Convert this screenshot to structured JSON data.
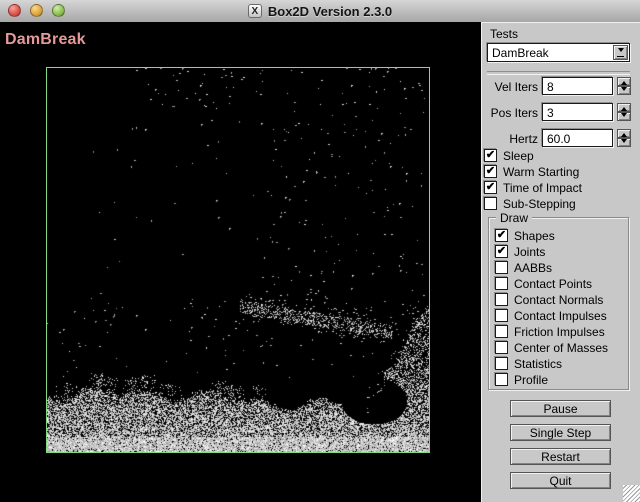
{
  "window": {
    "title": "Box2D Version 2.3.0"
  },
  "titlebar": {
    "app_icon_glyph": "X",
    "traffic_lights": [
      {
        "name": "close",
        "color": "#dd5149"
      },
      {
        "name": "minimize",
        "color": "#dda43c"
      },
      {
        "name": "zoom",
        "color": "#8abf4e"
      }
    ]
  },
  "viewport": {
    "test_label": "DamBreak",
    "label_color": "#e69999",
    "border_color": "#84da84",
    "background": "#000000"
  },
  "sidebar": {
    "tests_label": "Tests",
    "tests_value": "DamBreak",
    "spinners": [
      {
        "label": "Vel Iters",
        "value": "8"
      },
      {
        "label": "Pos Iters",
        "value": "3"
      },
      {
        "label": "Hertz",
        "value": "60.0"
      }
    ],
    "checkboxes": [
      {
        "label": "Sleep",
        "checked": true,
        "mark": "✔"
      },
      {
        "label": "Warm Starting",
        "checked": true,
        "mark": "✔"
      },
      {
        "label": "Time of Impact",
        "checked": true,
        "mark": "✔"
      },
      {
        "label": "Sub-Stepping",
        "checked": false,
        "mark": ""
      }
    ],
    "draw_group": {
      "label": "Draw",
      "items": [
        {
          "label": "Shapes",
          "checked": true,
          "mark": "✔"
        },
        {
          "label": "Joints",
          "checked": true,
          "mark": "✔"
        },
        {
          "label": "AABBs",
          "checked": false,
          "mark": ""
        },
        {
          "label": "Contact Points",
          "checked": false,
          "mark": ""
        },
        {
          "label": "Contact Normals",
          "checked": false,
          "mark": ""
        },
        {
          "label": "Contact Impulses",
          "checked": false,
          "mark": ""
        },
        {
          "label": "Friction Impulses",
          "checked": false,
          "mark": ""
        },
        {
          "label": "Center of Masses",
          "checked": false,
          "mark": ""
        },
        {
          "label": "Statistics",
          "checked": false,
          "mark": ""
        },
        {
          "label": "Profile",
          "checked": false,
          "mark": ""
        }
      ]
    },
    "buttons": [
      "Pause",
      "Single Step",
      "Restart",
      "Quit"
    ]
  }
}
